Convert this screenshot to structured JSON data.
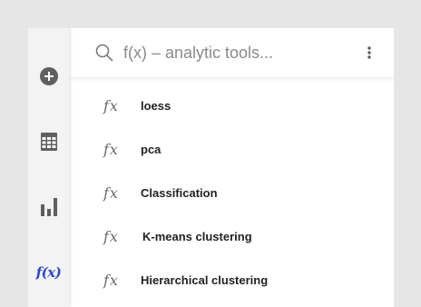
{
  "rail": {
    "items": [
      {
        "icon": "add-circle-icon",
        "active": false
      },
      {
        "icon": "table-icon",
        "active": false
      },
      {
        "icon": "bar-chart-icon",
        "active": false
      },
      {
        "icon": "fx-icon",
        "label": "f(x)",
        "active": true
      }
    ],
    "active_color": "#2d46c8",
    "icon_color": "#5f5f5f"
  },
  "search": {
    "placeholder": "f(x) – analytic tools...",
    "value": ""
  },
  "list": {
    "icon_label": "fx",
    "items": [
      {
        "label": "loess"
      },
      {
        "label": "pca"
      },
      {
        "label": "Classification"
      },
      {
        "label": "K-means clustering"
      },
      {
        "label": "Hierarchical clustering"
      }
    ]
  }
}
